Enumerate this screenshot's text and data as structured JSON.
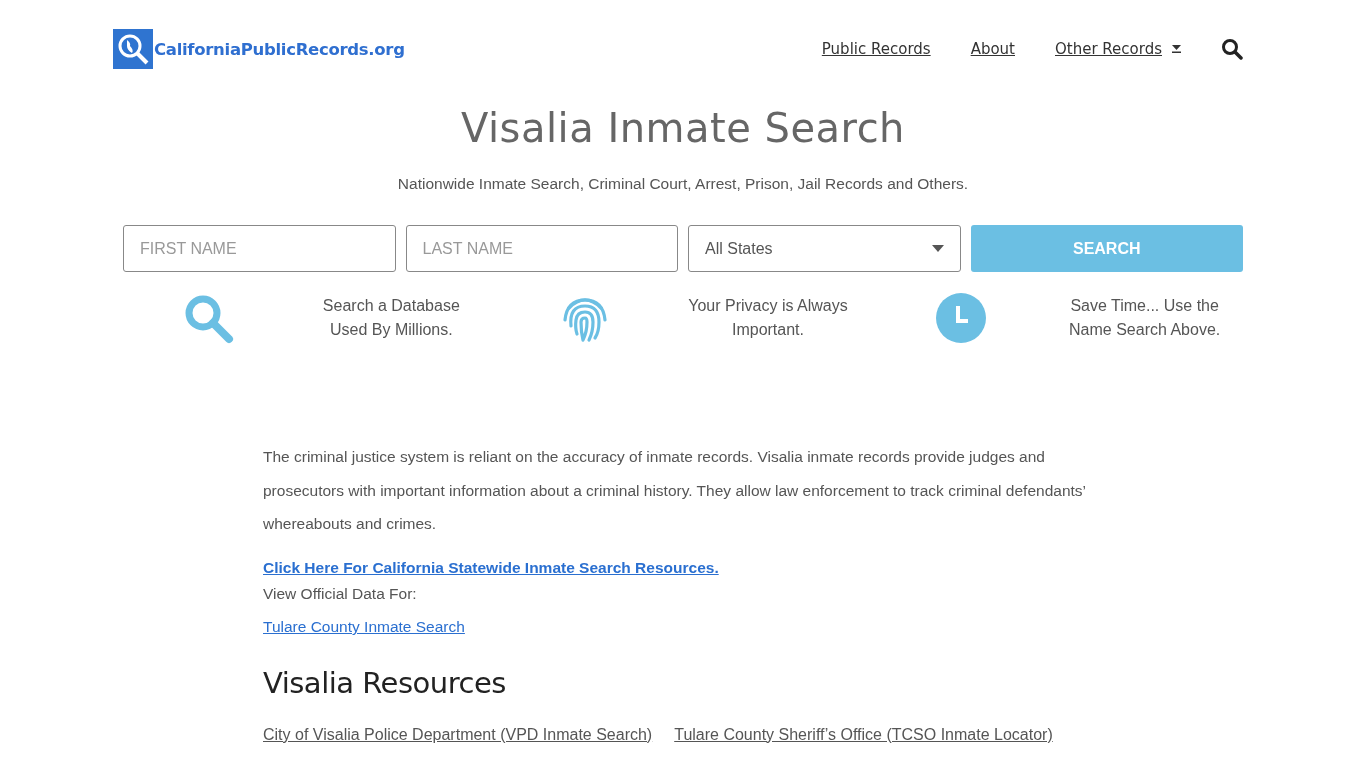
{
  "header": {
    "logo_text": "CaliforniaPublicRecords.org",
    "nav": [
      {
        "label": "Public Records",
        "dropdown": false
      },
      {
        "label": "About",
        "dropdown": false
      },
      {
        "label": "Other Records",
        "dropdown": true
      }
    ]
  },
  "hero": {
    "title": "Visalia Inmate Search",
    "subtitle": "Nationwide Inmate Search, Criminal Court, Arrest, Prison, Jail Records and Others.",
    "form": {
      "first_name": {
        "placeholder": "FIRST NAME"
      },
      "last_name": {
        "placeholder": "LAST NAME"
      },
      "state": {
        "value": "All States"
      },
      "button": "SEARCH"
    },
    "features": [
      {
        "kind": "search",
        "text": "Search a Database Used By Millions."
      },
      {
        "kind": "fingerprint",
        "text": "Your Privacy is Always Important."
      },
      {
        "kind": "clock",
        "text": "Save Time... Use the Name Search Above."
      }
    ]
  },
  "article": {
    "paragraph": "The criminal justice system is reliant on the accuracy of inmate records. Visalia inmate records provide judges and prosecutors with important information about a criminal history. They allow law enforcement to track criminal defendants’ whereabouts and crimes.",
    "statewide_link": "Click Here For California Statewide Inmate Search Resources.",
    "view_label": "View Official Data For:",
    "county_link": "Tulare County Inmate Search",
    "resources_heading": "Visalia Resources",
    "resources": [
      "City of Visalia Police Department (VPD Inmate Search)",
      "Tulare County Sheriff’s Office (TCSO Inmate Locator)"
    ]
  }
}
